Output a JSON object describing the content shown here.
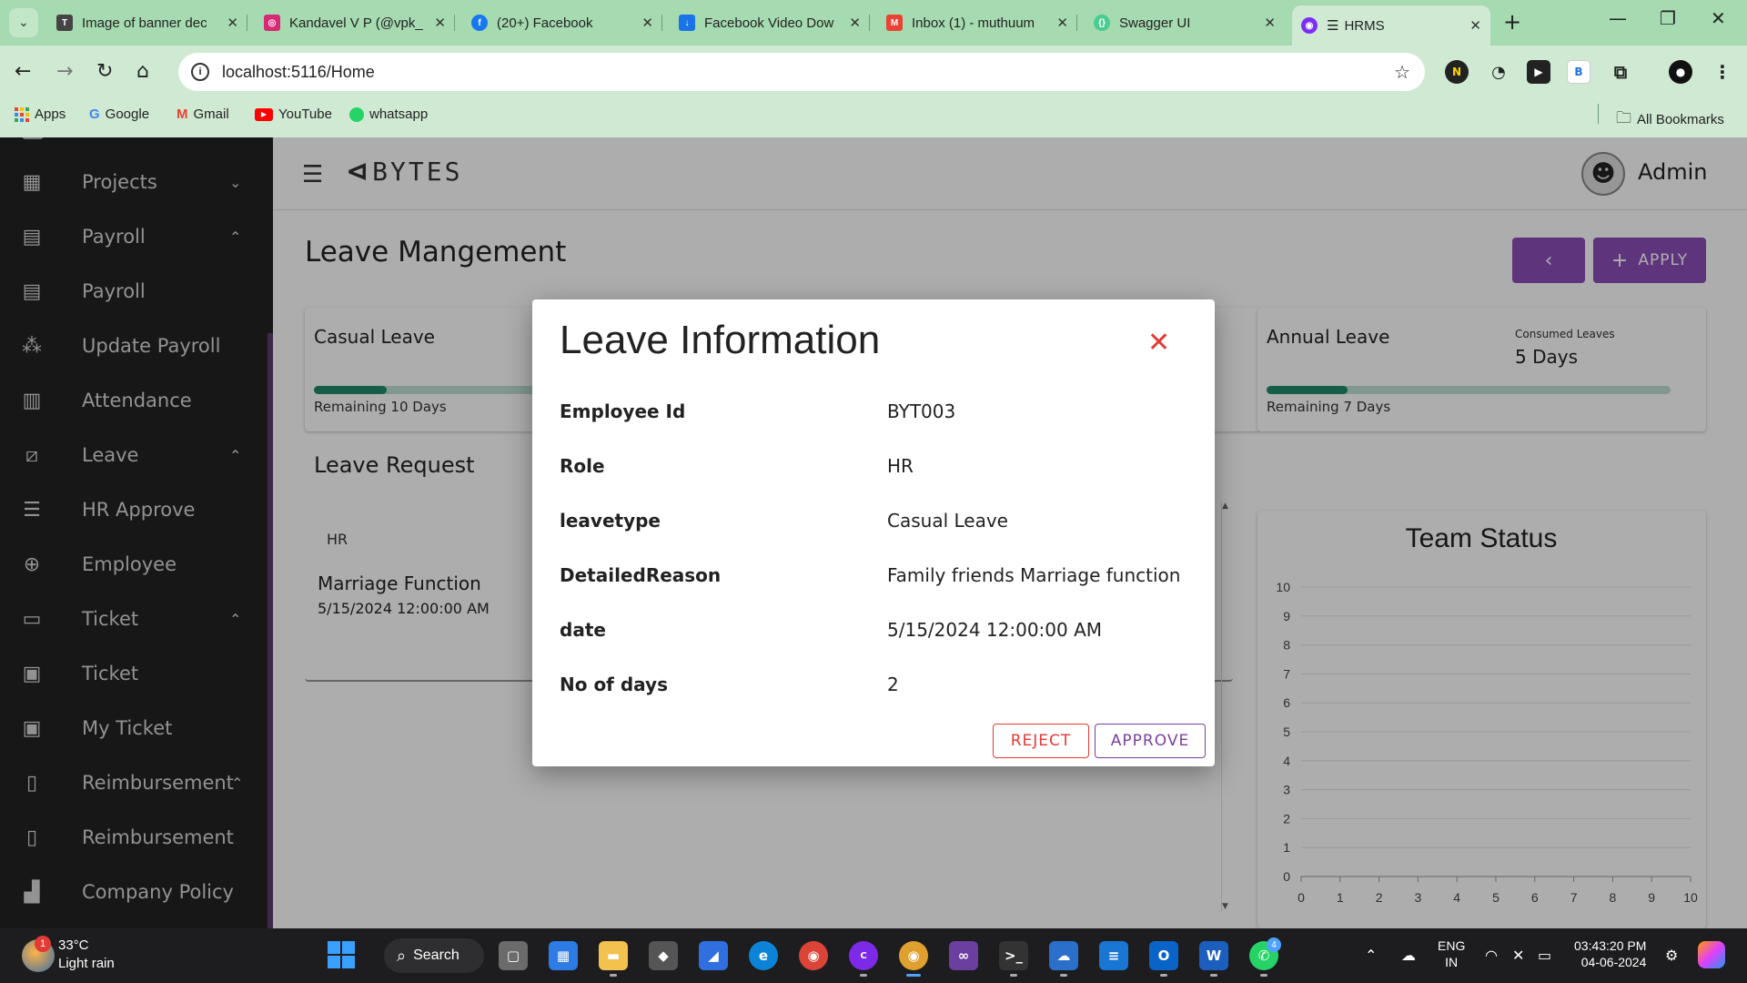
{
  "browser": {
    "tabs": [
      {
        "title": "Image of banner dec",
        "favicon": "template-icon",
        "color": "#444444"
      },
      {
        "title": "Kandavel V P (@vpk_",
        "favicon": "instagram-icon",
        "color": "#d62976"
      },
      {
        "title": "(20+) Facebook",
        "favicon": "facebook-icon",
        "color": "#1877f2"
      },
      {
        "title": "Facebook Video Dow",
        "favicon": "download-icon",
        "color": "#1a73e8"
      },
      {
        "title": "Inbox (1) - muthuum",
        "favicon": "gmail-icon",
        "color": "#ea4335"
      },
      {
        "title": "Swagger UI",
        "favicon": "swagger-icon",
        "color": "#49cc90"
      },
      {
        "title": "HRMS",
        "favicon": "hrms-icon",
        "color": "#7b2ff7"
      }
    ],
    "url": "localhost:5116/Home",
    "bookmarks": [
      "Apps",
      "Google",
      "Gmail",
      "YouTube",
      "whatsapp"
    ],
    "all_bookmarks": "All Bookmarks",
    "profile_initials": "B"
  },
  "sidebar": {
    "items": [
      {
        "label": "Projects",
        "icon": "projects-icon",
        "chevron": "down"
      },
      {
        "label": "Payroll",
        "icon": "payroll-icon",
        "chevron": "up"
      },
      {
        "label": "Payroll",
        "icon": "payroll-icon",
        "chevron": ""
      },
      {
        "label": "Update Payroll",
        "icon": "update-payroll-icon",
        "chevron": ""
      },
      {
        "label": "Attendance",
        "icon": "attendance-icon",
        "chevron": ""
      },
      {
        "label": "Leave",
        "icon": "leave-icon",
        "chevron": "up"
      },
      {
        "label": "HR Approve",
        "icon": "hr-approve-icon",
        "chevron": ""
      },
      {
        "label": "Employee",
        "icon": "employee-icon",
        "chevron": ""
      },
      {
        "label": "Ticket",
        "icon": "ticket-icon",
        "chevron": "up"
      },
      {
        "label": "Ticket",
        "icon": "ticket-icon",
        "chevron": ""
      },
      {
        "label": "My Ticket",
        "icon": "my-ticket-icon",
        "chevron": ""
      },
      {
        "label": "Reimbursement",
        "icon": "reimbursement-icon",
        "chevron": "up"
      },
      {
        "label": "Reimbursement",
        "icon": "reimbursement-icon",
        "chevron": ""
      },
      {
        "label": "Company Policy",
        "icon": "company-policy-icon",
        "chevron": ""
      }
    ]
  },
  "header": {
    "logo_text": "BYTES",
    "user_name": "Admin"
  },
  "page": {
    "title": "Leave Mangement",
    "apply_label": "APPLY",
    "casual_leave": {
      "title": "Casual Leave",
      "remaining": "Remaining 10 Days",
      "fraction": 0.2
    },
    "annual_leave": {
      "title": "Annual Leave",
      "consumed_label": "Consumed Leaves",
      "consumed_value": "5 Days",
      "remaining": "Remaining 7 Days",
      "fraction": 0.2
    },
    "leave_request": {
      "title": "Leave Request",
      "role": "HR",
      "reason": "Marriage Function",
      "date": "5/15/2024 12:00:00 AM"
    },
    "team_status": {
      "title": "Team Status"
    }
  },
  "chart_data": {
    "type": "line",
    "title": "Team Status",
    "xlim": [
      0,
      10
    ],
    "ylim": [
      0,
      10
    ],
    "x_ticks": [
      0,
      1,
      2,
      3,
      4,
      5,
      6,
      7,
      8,
      9,
      10
    ],
    "y_ticks": [
      0,
      1,
      2,
      3,
      4,
      5,
      6,
      7,
      8,
      9,
      10
    ],
    "series": [],
    "grid": true
  },
  "modal": {
    "title": "Leave Information",
    "fields": [
      {
        "label": "Employee Id",
        "value": "BYT003"
      },
      {
        "label": "Role",
        "value": "HR"
      },
      {
        "label": "leavetype",
        "value": "Casual Leave"
      },
      {
        "label": "DetailedReason",
        "value": "Family friends Marriage function"
      },
      {
        "label": "date",
        "value": "5/15/2024 12:00:00 AM"
      },
      {
        "label": "No of days",
        "value": "2"
      }
    ],
    "reject_label": "REJECT",
    "approve_label": "APPROVE",
    "colors": {
      "reject": "#e53935",
      "approve": "#7b3fa0",
      "close": "#e53935"
    }
  },
  "taskbar": {
    "weather_temp": "33°C",
    "weather_desc": "Light rain",
    "weather_badge": "1",
    "search_label": "Search",
    "lang_top": "ENG",
    "lang_bottom": "IN",
    "time": "03:43:20 PM",
    "date": "04-06-2024",
    "whatsapp_badge": "4"
  },
  "theme": {
    "purple": "#8b4fb8",
    "sidebar_bg": "#232323",
    "progress": "#1f8a6a"
  }
}
